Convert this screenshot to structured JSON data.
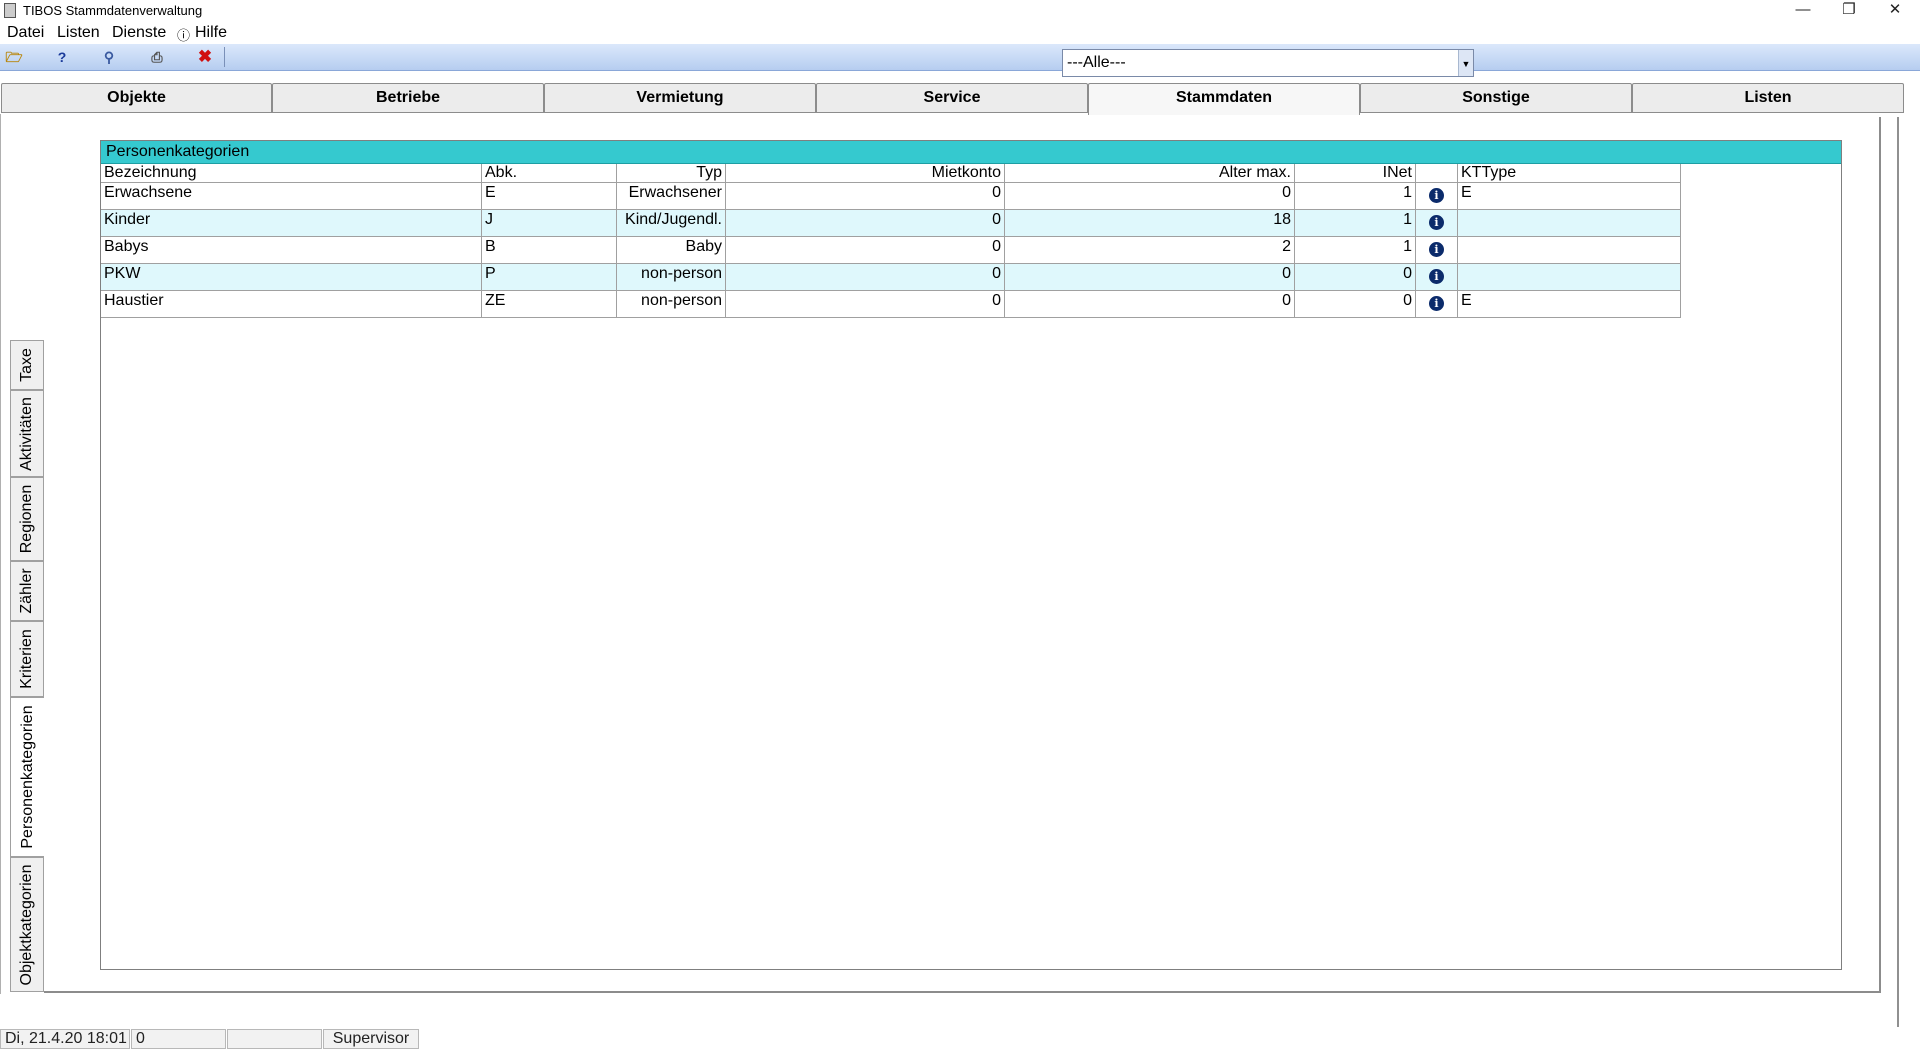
{
  "window": {
    "title": "TIBOS Stammdatenverwaltung"
  },
  "menu": [
    "Datei",
    "Listen",
    "Dienste",
    "Hilfe"
  ],
  "toolbar": {
    "filter_value": "---Alle---"
  },
  "tabs": [
    "Objekte",
    "Betriebe",
    "Vermietung",
    "Service",
    "Stammdaten",
    "Sonstige",
    "Listen"
  ],
  "active_tab": "Stammdaten",
  "side_tabs": [
    "Taxe",
    "Aktivitäten",
    "Regionen",
    "Zähler",
    "Kriterien",
    "Personenkategorien",
    "Objektkategorien"
  ],
  "active_side_tab": "Personenkategorien",
  "grid": {
    "title": "Personenkategorien",
    "columns": [
      "Bezeichnung",
      "Abk.",
      "Typ",
      "Mietkonto",
      "Alter max.",
      "INet",
      "",
      "KTType"
    ],
    "rows": [
      {
        "bezeichnung": "Erwachsene",
        "abk": "E",
        "typ": "Erwachsener",
        "mietkonto": "0",
        "alter": "0",
        "inet": "1",
        "kttype": "E"
      },
      {
        "bezeichnung": "Kinder",
        "abk": "J",
        "typ": "Kind/Jugendl.",
        "mietkonto": "0",
        "alter": "18",
        "inet": "1",
        "kttype": ""
      },
      {
        "bezeichnung": "Babys",
        "abk": "B",
        "typ": "Baby",
        "mietkonto": "0",
        "alter": "2",
        "inet": "1",
        "kttype": ""
      },
      {
        "bezeichnung": "PKW",
        "abk": "P",
        "typ": "non-person",
        "mietkonto": "0",
        "alter": "0",
        "inet": "0",
        "kttype": ""
      },
      {
        "bezeichnung": "Haustier",
        "abk": "ZE",
        "typ": "non-person",
        "mietkonto": "0",
        "alter": "0",
        "inet": "0",
        "kttype": "E"
      }
    ]
  },
  "status": {
    "datetime": "Di, 21.4.20 18:01",
    "count": "0",
    "field3": "",
    "user": "Supervisor"
  }
}
